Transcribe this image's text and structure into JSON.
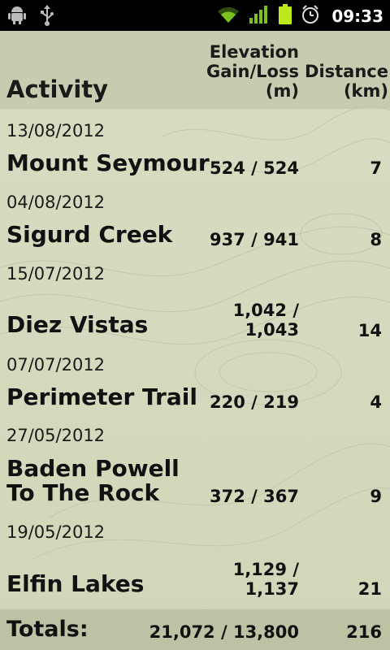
{
  "status_bar": {
    "time": "09:33",
    "icons": [
      "android-debug-icon",
      "usb-icon",
      "wifi-icon",
      "signal-icon",
      "battery-icon",
      "alarm-icon"
    ]
  },
  "header": {
    "activity_label": "Activity",
    "elevation_line1": "Elevation",
    "elevation_line2": "Gain/Loss",
    "elevation_line3": "(m)",
    "distance_line1": "Distance",
    "distance_line2": "(km)"
  },
  "activities": [
    {
      "date": "13/08/2012",
      "name": "Mount Seymour",
      "elevation": "524 / 524",
      "distance": "7"
    },
    {
      "date": "04/08/2012",
      "name": "Sigurd Creek",
      "elevation": "937 / 941",
      "distance": "8"
    },
    {
      "date": "15/07/2012",
      "name": "Diez Vistas",
      "elevation_line1": "1,042 /",
      "elevation_line2": "1,043",
      "distance": "14"
    },
    {
      "date": "07/07/2012",
      "name": "Perimeter Trail",
      "elevation": "220 / 219",
      "distance": "4"
    },
    {
      "date": "27/05/2012",
      "name_line1": "Baden Powell",
      "name_line2": "To The Rock",
      "elevation": "372 / 367",
      "distance": "9"
    },
    {
      "date": "19/05/2012",
      "name": "Elfin Lakes",
      "elevation_line1": "1,129 /",
      "elevation_line2": "1,137",
      "distance": "21"
    }
  ],
  "totals": {
    "label": "Totals:",
    "elevation": "21,072 / 13,800",
    "distance": "216"
  },
  "colors": {
    "background": "#d9dcc0",
    "header_band": "#b9bea0",
    "text": "#111111"
  }
}
